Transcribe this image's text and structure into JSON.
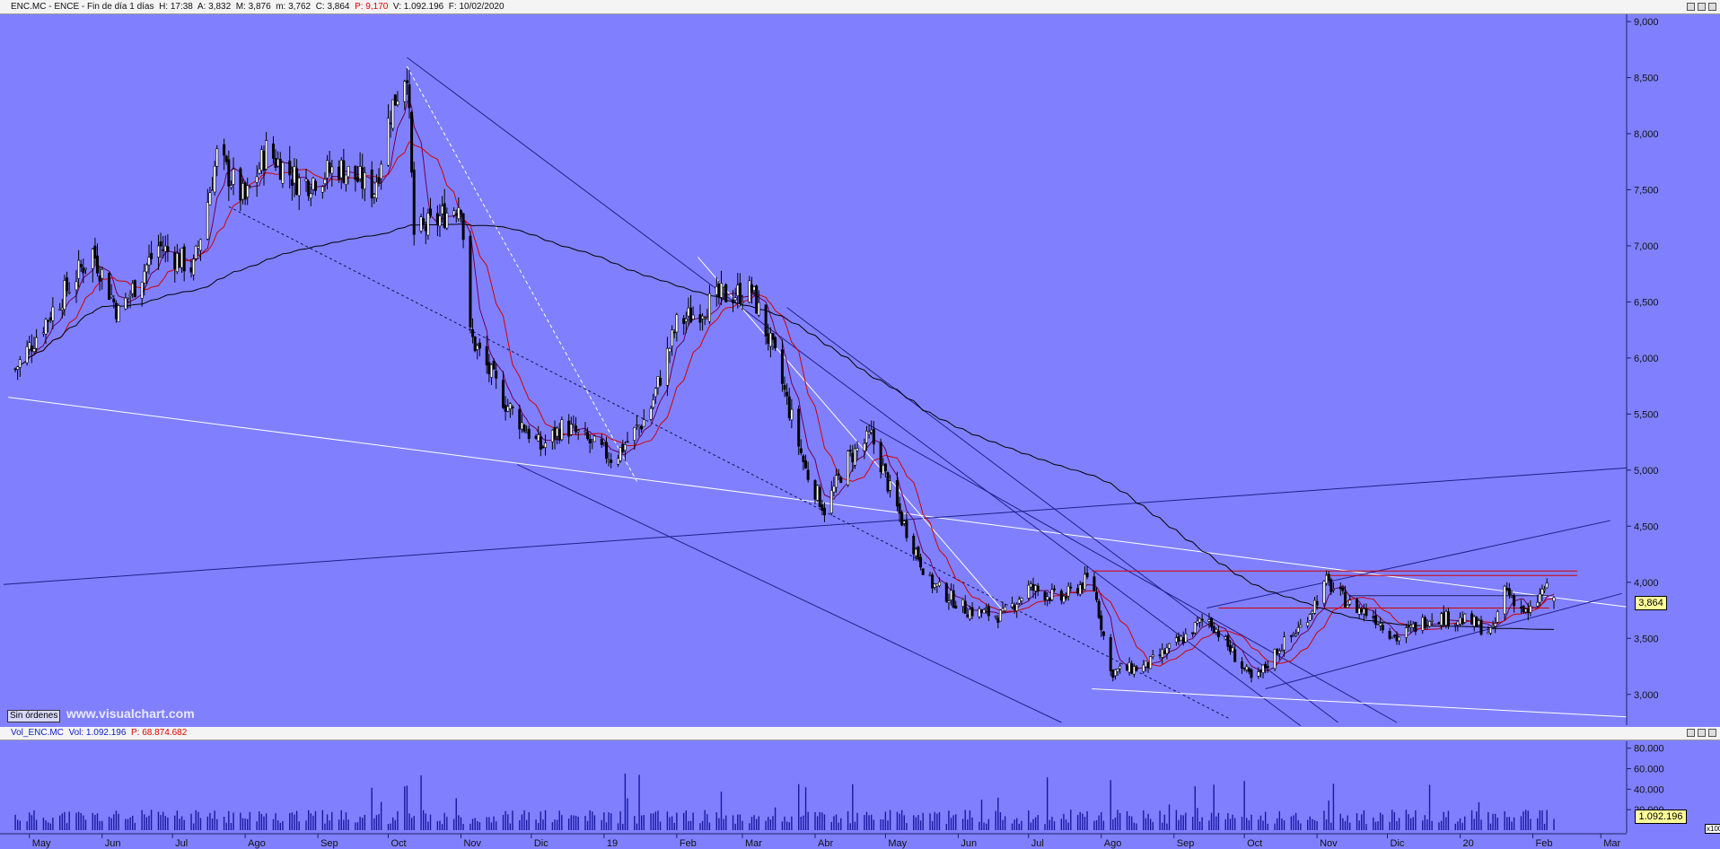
{
  "header": {
    "symbol": "ENC.MC - ENCE - Fin de día 1 días",
    "high": "H: 17:38",
    "ask": "A: 3,832",
    "max": "M: 3,876",
    "min": "m: 3,762",
    "close": "C: 3,864",
    "p_label": "P: 9,170",
    "volume": "V: 1.092.196",
    "date": "F: 10/02/2020"
  },
  "volume_header": {
    "name": "Vol_ENC.MC",
    "vol": "Vol: 1.092.196",
    "p_label": "P: 68.874.682"
  },
  "status": {
    "orders_button": "Sin órdenes",
    "watermark": "www.visualchart.com"
  },
  "current_price_label": "3,864",
  "current_volume_label": "1.092.196",
  "volume_scale_note": "x100",
  "colors": {
    "background": "#8080ff",
    "candle": "#000000",
    "ma_fast": "#d00000",
    "ma_slow": "#6a0050",
    "ma_long": "#000000",
    "trendline_white": "#ffffff",
    "trendline_blue": "#20208a",
    "resistance_red": "#d00000"
  },
  "chart_data": [
    {
      "type": "candlestick",
      "title": "ENC.MC - ENCE",
      "y_ticks": [
        "9,000",
        "8,500",
        "8,000",
        "7,500",
        "7,000",
        "6,500",
        "6,000",
        "5,500",
        "5,000",
        "4,500",
        "4,000",
        "3,500",
        "3,000"
      ],
      "ylim": [
        2.75,
        9.0
      ],
      "x_ticks": [
        "May",
        "Jun",
        "Jul",
        "Ago",
        "Sep",
        "Oct",
        "Nov",
        "Dic",
        "19",
        "Feb",
        "Mar",
        "Abr",
        "May",
        "Jun",
        "Jul",
        "Ago",
        "Sep",
        "Oct",
        "Nov",
        "Dic",
        "20",
        "Feb",
        "Mar"
      ],
      "price_path": [
        {
          "t": "2018-04-25",
          "close": 5.9
        },
        {
          "t": "2018-05-10",
          "close": 6.4
        },
        {
          "t": "2018-05-28",
          "close": 6.95
        },
        {
          "t": "2018-06-08",
          "close": 6.4
        },
        {
          "t": "2018-06-25",
          "close": 7.0
        },
        {
          "t": "2018-07-10",
          "close": 6.8
        },
        {
          "t": "2018-07-20",
          "close": 7.8
        },
        {
          "t": "2018-08-01",
          "close": 7.4
        },
        {
          "t": "2018-08-10",
          "close": 7.85
        },
        {
          "t": "2018-08-25",
          "close": 7.55
        },
        {
          "t": "2018-09-10",
          "close": 7.7
        },
        {
          "t": "2018-09-25",
          "close": 7.5
        },
        {
          "t": "2018-10-02",
          "close": 8.2
        },
        {
          "t": "2018-10-09",
          "close": 8.6
        },
        {
          "t": "2018-10-12",
          "close": 7.1
        },
        {
          "t": "2018-10-20",
          "close": 7.2
        },
        {
          "t": "2018-11-01",
          "close": 7.4
        },
        {
          "t": "2018-11-05",
          "close": 6.2
        },
        {
          "t": "2018-11-20",
          "close": 5.6
        },
        {
          "t": "2018-12-05",
          "close": 5.2
        },
        {
          "t": "2018-12-15",
          "close": 5.4
        },
        {
          "t": "2019-01-05",
          "close": 5.1
        },
        {
          "t": "2019-01-20",
          "close": 5.5
        },
        {
          "t": "2019-02-01",
          "close": 6.3
        },
        {
          "t": "2019-02-20",
          "close": 6.55
        },
        {
          "t": "2019-03-05",
          "close": 6.6
        },
        {
          "t": "2019-03-15",
          "close": 6.0
        },
        {
          "t": "2019-03-28",
          "close": 5.0
        },
        {
          "t": "2019-04-05",
          "close": 4.65
        },
        {
          "t": "2019-04-15",
          "close": 5.1
        },
        {
          "t": "2019-04-25",
          "close": 5.3
        },
        {
          "t": "2019-05-05",
          "close": 4.7
        },
        {
          "t": "2019-05-20",
          "close": 4.0
        },
        {
          "t": "2019-06-05",
          "close": 3.75
        },
        {
          "t": "2019-06-20",
          "close": 3.7
        },
        {
          "t": "2019-07-01",
          "close": 3.95
        },
        {
          "t": "2019-07-15",
          "close": 3.85
        },
        {
          "t": "2019-07-28",
          "close": 4.05
        },
        {
          "t": "2019-08-05",
          "close": 3.2
        },
        {
          "t": "2019-08-20",
          "close": 3.25
        },
        {
          "t": "2019-09-05",
          "close": 3.5
        },
        {
          "t": "2019-09-15",
          "close": 3.7
        },
        {
          "t": "2019-09-25",
          "close": 3.4
        },
        {
          "t": "2019-10-05",
          "close": 3.1
        },
        {
          "t": "2019-10-15",
          "close": 3.4
        },
        {
          "t": "2019-10-25",
          "close": 3.6
        },
        {
          "t": "2019-11-05",
          "close": 4.0
        },
        {
          "t": "2019-11-15",
          "close": 3.8
        },
        {
          "t": "2019-11-25",
          "close": 3.7
        },
        {
          "t": "2019-12-05",
          "close": 3.5
        },
        {
          "t": "2019-12-20",
          "close": 3.7
        },
        {
          "t": "2020-01-05",
          "close": 3.65
        },
        {
          "t": "2020-01-15",
          "close": 3.55
        },
        {
          "t": "2020-01-20",
          "close": 3.95
        },
        {
          "t": "2020-01-30",
          "close": 3.7
        },
        {
          "t": "2020-02-06",
          "close": 3.95
        },
        {
          "t": "2020-02-10",
          "open": 3.832,
          "high": 3.876,
          "low": 3.762,
          "close": 3.864
        }
      ]
    },
    {
      "type": "bar",
      "title": "Vol_ENC.MC",
      "y_ticks": [
        "80.000",
        "60.000",
        "40.000",
        "20.000"
      ],
      "ylim": [
        0,
        85000
      ],
      "unit_multiplier": 100,
      "last_value": 1092196
    }
  ]
}
